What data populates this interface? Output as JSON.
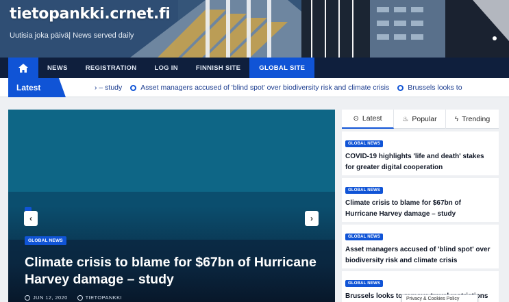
{
  "header": {
    "site_title": "tietopankki.crnet.fi",
    "tagline": "Uutisia joka päivä| News served daily"
  },
  "nav": {
    "items": [
      {
        "label": "NEWS",
        "active": false
      },
      {
        "label": "REGISTRATION",
        "active": false
      },
      {
        "label": "LOG IN",
        "active": false
      },
      {
        "label": "FINNISH SITE",
        "active": false
      },
      {
        "label": "GLOBAL SITE",
        "active": true
      }
    ],
    "home_icon": "home-icon"
  },
  "ticker": {
    "label": "Latest",
    "fragment": "› – study",
    "items": [
      "Asset managers accused of 'blind spot' over biodiversity risk and climate crisis",
      "Brussels looks to"
    ]
  },
  "hero": {
    "category": "GLOBAL NEWS",
    "title": "Climate crisis to blame for $67bn of Hurricane Harvey damage – study",
    "date": "JUN 12, 2020",
    "author": "TIETOPANKKI"
  },
  "sidebar": {
    "tabs": [
      {
        "label": "Latest",
        "icon": "clock-icon",
        "glyph": "⊙"
      },
      {
        "label": "Popular",
        "icon": "fire-icon",
        "glyph": "♨"
      },
      {
        "label": "Trending",
        "icon": "bolt-icon",
        "glyph": "ϟ"
      }
    ],
    "posts": [
      {
        "category": "GLOBAL NEWS",
        "title": "COVID-19 highlights 'life and death' stakes for greater digital cooperation"
      },
      {
        "category": "GLOBAL NEWS",
        "title": "Climate crisis to blame for $67bn of Hurricane Harvey damage – study"
      },
      {
        "category": "GLOBAL NEWS",
        "title": "Asset managers accused of 'blind spot' over biodiversity risk and climate crisis"
      },
      {
        "category": "GLOBAL NEWS",
        "title": "Brussels looks to remove travel restrictions"
      }
    ]
  },
  "cookie": {
    "label": "Privacy & Cookies Policy"
  },
  "colors": {
    "accent": "#1054d6",
    "nav_bg": "#0f1f3d"
  }
}
